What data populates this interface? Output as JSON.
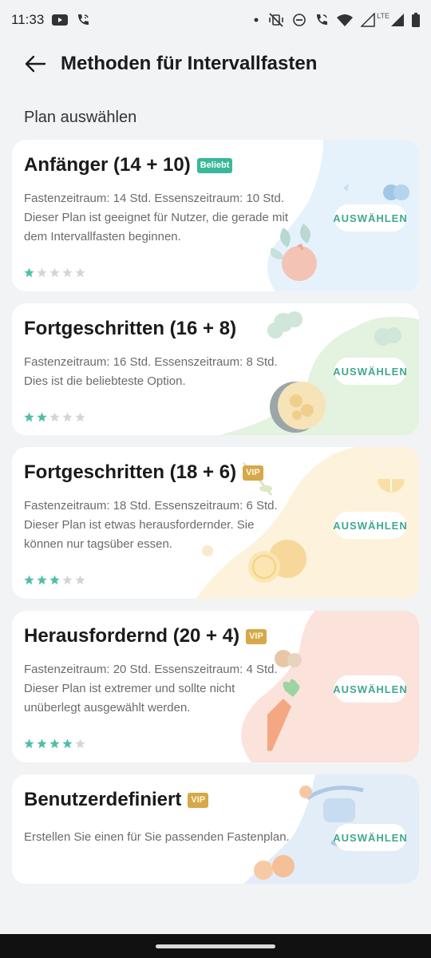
{
  "status": {
    "time": "11:33",
    "lte": "LTE"
  },
  "header": {
    "title": "Methoden für Intervallfasten"
  },
  "section_label": "Plan auswählen",
  "colors": {
    "accent": "#3fa890",
    "star_on": "#4fbfa5",
    "star_off": "#d5d5d5",
    "vip": "#d6a84a",
    "popular": "#3ab89a"
  },
  "plans": [
    {
      "title": "Anfänger (14 + 10)",
      "badge": "Beliebt",
      "desc1": "Fastenzeitraum: 14 Std. Essenszeitraum: 10 Std.",
      "desc2": "Dieser Plan ist geeignet für Nutzer, die gerade mit",
      "desc3": "dem Intervallfasten beginnen.",
      "stars": 1,
      "button": "AUSWÄHLEN"
    },
    {
      "title": "Fortgeschritten (16 + 8)",
      "badge": "",
      "desc1": "Fastenzeitraum: 16 Std. Essenszeitraum: 8 Std.",
      "desc2": "Dies ist die beliebteste Option.",
      "desc3": "",
      "stars": 2,
      "button": "AUSWÄHLEN"
    },
    {
      "title": "Fortgeschritten (18 + 6)",
      "badge": "VIP",
      "desc1": "Fastenzeitraum: 18 Std. Essenszeitraum: 6 Std.",
      "desc2": "Dieser Plan ist etwas herausfordernder. Sie",
      "desc3": "können nur tagsüber essen.",
      "stars": 3,
      "button": "AUSWÄHLEN"
    },
    {
      "title": "Herausfordernd (20 + 4)",
      "badge": "VIP",
      "desc1": "Fastenzeitraum: 20 Std. Essenszeitraum: 4 Std.",
      "desc2": "Dieser Plan ist extremer und sollte nicht",
      "desc3": "unüberlegt ausgewählt werden.",
      "stars": 4,
      "button": "AUSWÄHLEN"
    },
    {
      "title": "Benutzerdefiniert",
      "badge": "VIP",
      "desc1": "Erstellen Sie einen für Sie passenden Fastenplan.",
      "desc2": "",
      "desc3": "",
      "stars": 0,
      "button": "AUSWÄHLEN"
    }
  ]
}
